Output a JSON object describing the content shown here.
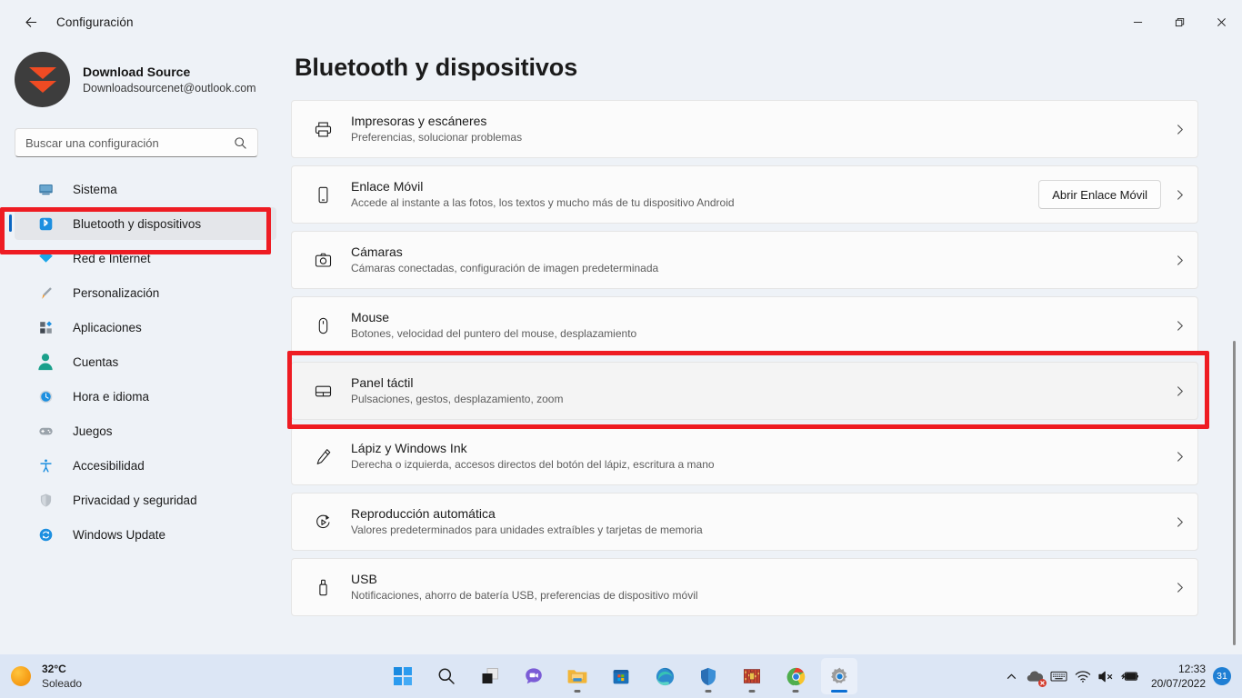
{
  "window": {
    "app_title": "Configuración",
    "back_icon": "back-arrow-icon",
    "minimize_label": "—",
    "restore_label": "restore",
    "close_label": "✕"
  },
  "sidebar": {
    "profile": {
      "name": "Download Source",
      "email": "Downloadsourcenet@outlook.com",
      "avatar_icon": "download-chevrons-avatar"
    },
    "search": {
      "placeholder": "Buscar una configuración",
      "icon": "search-icon",
      "value": ""
    },
    "items": [
      {
        "label": "Sistema",
        "icon": "monitor-icon",
        "selected": false
      },
      {
        "label": "Bluetooth y dispositivos",
        "icon": "bluetooth-icon",
        "selected": true
      },
      {
        "label": "Red e Internet",
        "icon": "wifi-icon",
        "selected": false
      },
      {
        "label": "Personalización",
        "icon": "paintbrush-icon",
        "selected": false
      },
      {
        "label": "Aplicaciones",
        "icon": "apps-grid-icon",
        "selected": false
      },
      {
        "label": "Cuentas",
        "icon": "person-icon",
        "selected": false
      },
      {
        "label": "Hora e idioma",
        "icon": "clock-icon",
        "selected": false
      },
      {
        "label": "Juegos",
        "icon": "gamepad-icon",
        "selected": false
      },
      {
        "label": "Accesibilidad",
        "icon": "accessibility-icon",
        "selected": false
      },
      {
        "label": "Privacidad y seguridad",
        "icon": "shield-icon",
        "selected": false
      },
      {
        "label": "Windows Update",
        "icon": "update-refresh-icon",
        "selected": false
      }
    ]
  },
  "main": {
    "page_title": "Bluetooth y dispositivos",
    "cards": [
      {
        "title": "Impresoras y escáneres",
        "subtitle": "Preferencias, solucionar problemas",
        "icon": "printer-icon",
        "action": null,
        "hover": false
      },
      {
        "title": "Enlace Móvil",
        "subtitle": "Accede al instante a las fotos, los textos y mucho más de tu dispositivo Android",
        "icon": "phone-icon",
        "action": "Abrir Enlace Móvil",
        "hover": false
      },
      {
        "title": "Cámaras",
        "subtitle": "Cámaras conectadas, configuración de imagen predeterminada",
        "icon": "camera-icon",
        "action": null,
        "hover": false
      },
      {
        "title": "Mouse",
        "subtitle": "Botones, velocidad del puntero del mouse, desplazamiento",
        "icon": "mouse-icon",
        "action": null,
        "hover": false
      },
      {
        "title": "Panel táctil",
        "subtitle": "Pulsaciones, gestos, desplazamiento, zoom",
        "icon": "touchpad-icon",
        "action": null,
        "hover": true
      },
      {
        "title": "Lápiz y Windows Ink",
        "subtitle": "Derecha o izquierda, accesos directos del botón del lápiz, escritura a mano",
        "icon": "pen-icon",
        "action": null,
        "hover": false
      },
      {
        "title": "Reproducción automática",
        "subtitle": "Valores predeterminados para unidades extraíbles y tarjetas de memoria",
        "icon": "autoplay-icon",
        "action": null,
        "hover": false
      },
      {
        "title": "USB",
        "subtitle": "Notificaciones, ahorro de batería USB, preferencias de dispositivo móvil",
        "icon": "usb-icon",
        "action": null,
        "hover": false
      }
    ]
  },
  "annotations": {
    "highlight_color": "#ee1c23",
    "highlighted_sidebar_item": "Bluetooth y dispositivos",
    "highlighted_card": "Panel táctil"
  },
  "taskbar": {
    "weather": {
      "temperature": "32°C",
      "condition": "Soleado",
      "icon": "sun-icon"
    },
    "apps": [
      {
        "name": "start-button",
        "running": false,
        "active": false
      },
      {
        "name": "search-taskbar-button",
        "running": false,
        "active": false
      },
      {
        "name": "task-view-button",
        "running": false,
        "active": false
      },
      {
        "name": "chat-button",
        "running": false,
        "active": false
      },
      {
        "name": "file-explorer-button",
        "running": true,
        "active": false
      },
      {
        "name": "microsoft-store-button",
        "running": false,
        "active": false
      },
      {
        "name": "edge-button",
        "running": false,
        "active": false
      },
      {
        "name": "windows-security-button",
        "running": true,
        "active": false
      },
      {
        "name": "winrar-button",
        "running": true,
        "active": false
      },
      {
        "name": "chrome-button",
        "running": true,
        "active": false
      },
      {
        "name": "settings-button",
        "running": true,
        "active": true
      }
    ],
    "tray": {
      "chevron_icon": "chevron-up-icon",
      "onedrive_icon": "onedrive-error-icon",
      "keyboard_icon": "keyboard-icon",
      "network_icon": "wifi-icon",
      "volume_icon": "volume-muted-icon",
      "battery_icon": "battery-charging-icon",
      "time": "12:33",
      "date": "20/07/2022",
      "notification_count": "31"
    }
  }
}
